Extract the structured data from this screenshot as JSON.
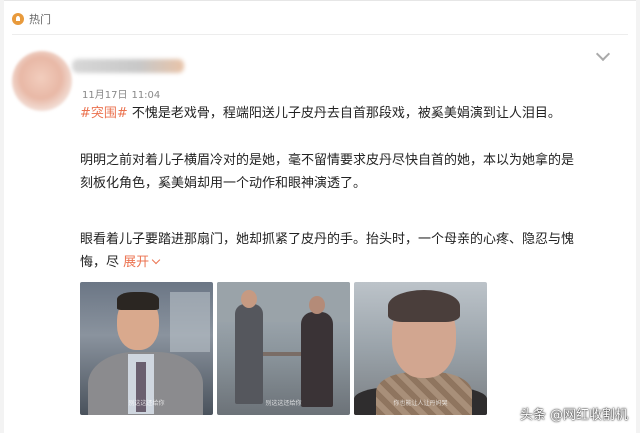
{
  "header": {
    "hot_label": "热门"
  },
  "post": {
    "timestamp": "11月17日",
    "time": "11:04",
    "topic": "#突围#",
    "paragraph1_rest": " 不愧是老戏骨，程端阳送儿子皮丹去自首那段戏，被奚美娟演到让人泪目。",
    "paragraph2_line1": "明明之前对着儿子横眉冷对的是她，毫不留情要求皮丹尽快自首的她，本以为她拿的是",
    "paragraph2_line2": "刻板化角色，奚美娟却用一个动作和眼神演透了。",
    "paragraph3_line1": "眼看着儿子要踏进那扇门，她却抓紧了皮丹的手。抬头时，一个母亲的心疼、隐忍与愧",
    "paragraph3_line2": "悔，尽 ",
    "expand_label": "展开",
    "images": [
      {
        "subtitle": "别这这还给你"
      },
      {
        "subtitle": "别这这还给你"
      },
      {
        "subtitle": "你也能让人让丹妈哭"
      }
    ]
  },
  "watermark": "头条 @网红收割机",
  "colors": {
    "accent": "#eb7350",
    "background": "#ffffff",
    "text": "#222222"
  },
  "icons": [
    "hot-icon",
    "chevron-down-icon"
  ]
}
